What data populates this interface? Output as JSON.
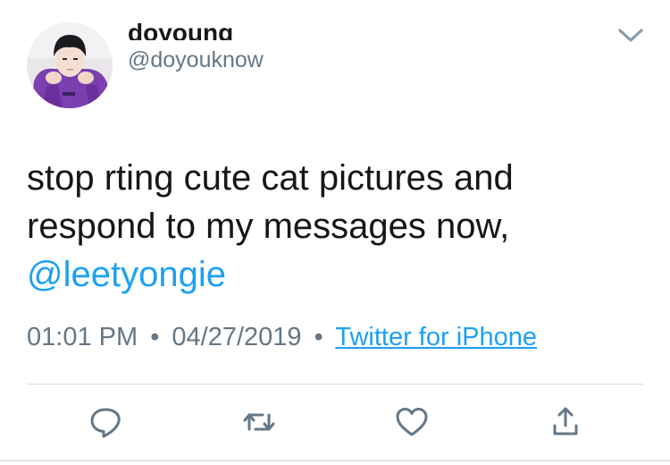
{
  "tweet": {
    "display_name": "doyoung",
    "handle": "@doyouknow",
    "text": "stop rting cute cat pictures and respond to my messages now, ",
    "mention": "@leetyongie",
    "time": "01:01 PM",
    "separator": "•",
    "date": "04/27/2019",
    "source": "Twitter for iPhone"
  },
  "icons": {
    "more": "chevron-down-icon",
    "reply": "reply-icon",
    "retweet": "retweet-icon",
    "like": "heart-icon",
    "share": "share-icon"
  },
  "colors": {
    "link": "#1da1f2",
    "secondary_text": "#657786",
    "primary_text": "#14171a",
    "icon": "#657786"
  }
}
